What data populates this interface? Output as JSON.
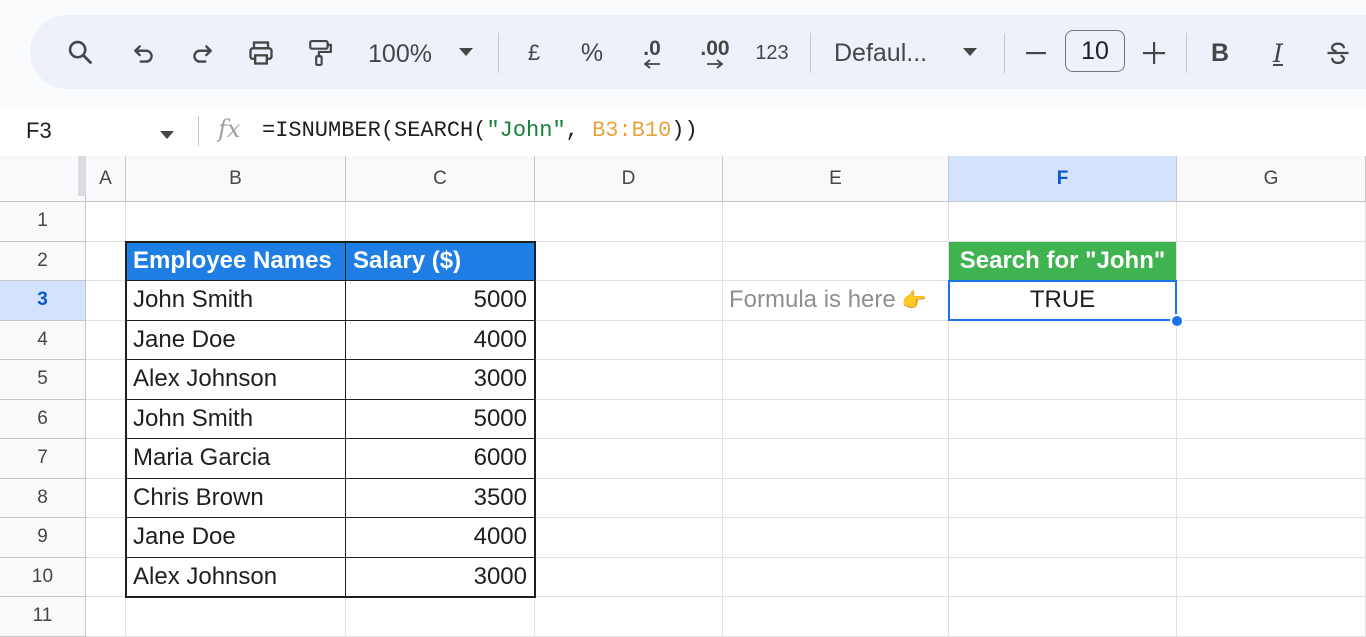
{
  "toolbar": {
    "zoom": "100%",
    "currency": "£",
    "percent": "%",
    "decrease_decimal": ".0",
    "increase_decimal": ".00",
    "number_format": "123",
    "font": "Defaul...",
    "font_size": "10",
    "bold": "B",
    "italic": "I"
  },
  "formula_bar": {
    "cell_ref": "F3",
    "fx": "fx",
    "formula_prefix": "=ISNUMBER(SEARCH(",
    "formula_string": "\"John\"",
    "formula_comma": ", ",
    "formula_range": "B3:B10",
    "formula_suffix": "))"
  },
  "grid": {
    "columns": [
      "A",
      "B",
      "C",
      "D",
      "E",
      "F",
      "G"
    ],
    "rows": [
      "1",
      "2",
      "3",
      "4",
      "5",
      "6",
      "7",
      "8",
      "9",
      "10",
      "11"
    ],
    "selected_column": "F",
    "selected_row": "3"
  },
  "table": {
    "headers": [
      "Employee Names",
      "Salary ($)"
    ],
    "rows": [
      [
        "John Smith",
        "5000"
      ],
      [
        "Jane Doe",
        "4000"
      ],
      [
        "Alex Johnson",
        "3000"
      ],
      [
        "John Smith",
        "5000"
      ],
      [
        "Maria Garcia",
        "6000"
      ],
      [
        "Chris Brown",
        "3500"
      ],
      [
        "Jane Doe",
        "4000"
      ],
      [
        "Alex Johnson",
        "3000"
      ]
    ]
  },
  "search": {
    "header": "Search for \"John\"",
    "result": "TRUE",
    "note": "Formula is here"
  },
  "colors": {
    "table_header": "#1e7ee3",
    "search_header": "#3fb34f",
    "selection": "#1a73e8"
  }
}
